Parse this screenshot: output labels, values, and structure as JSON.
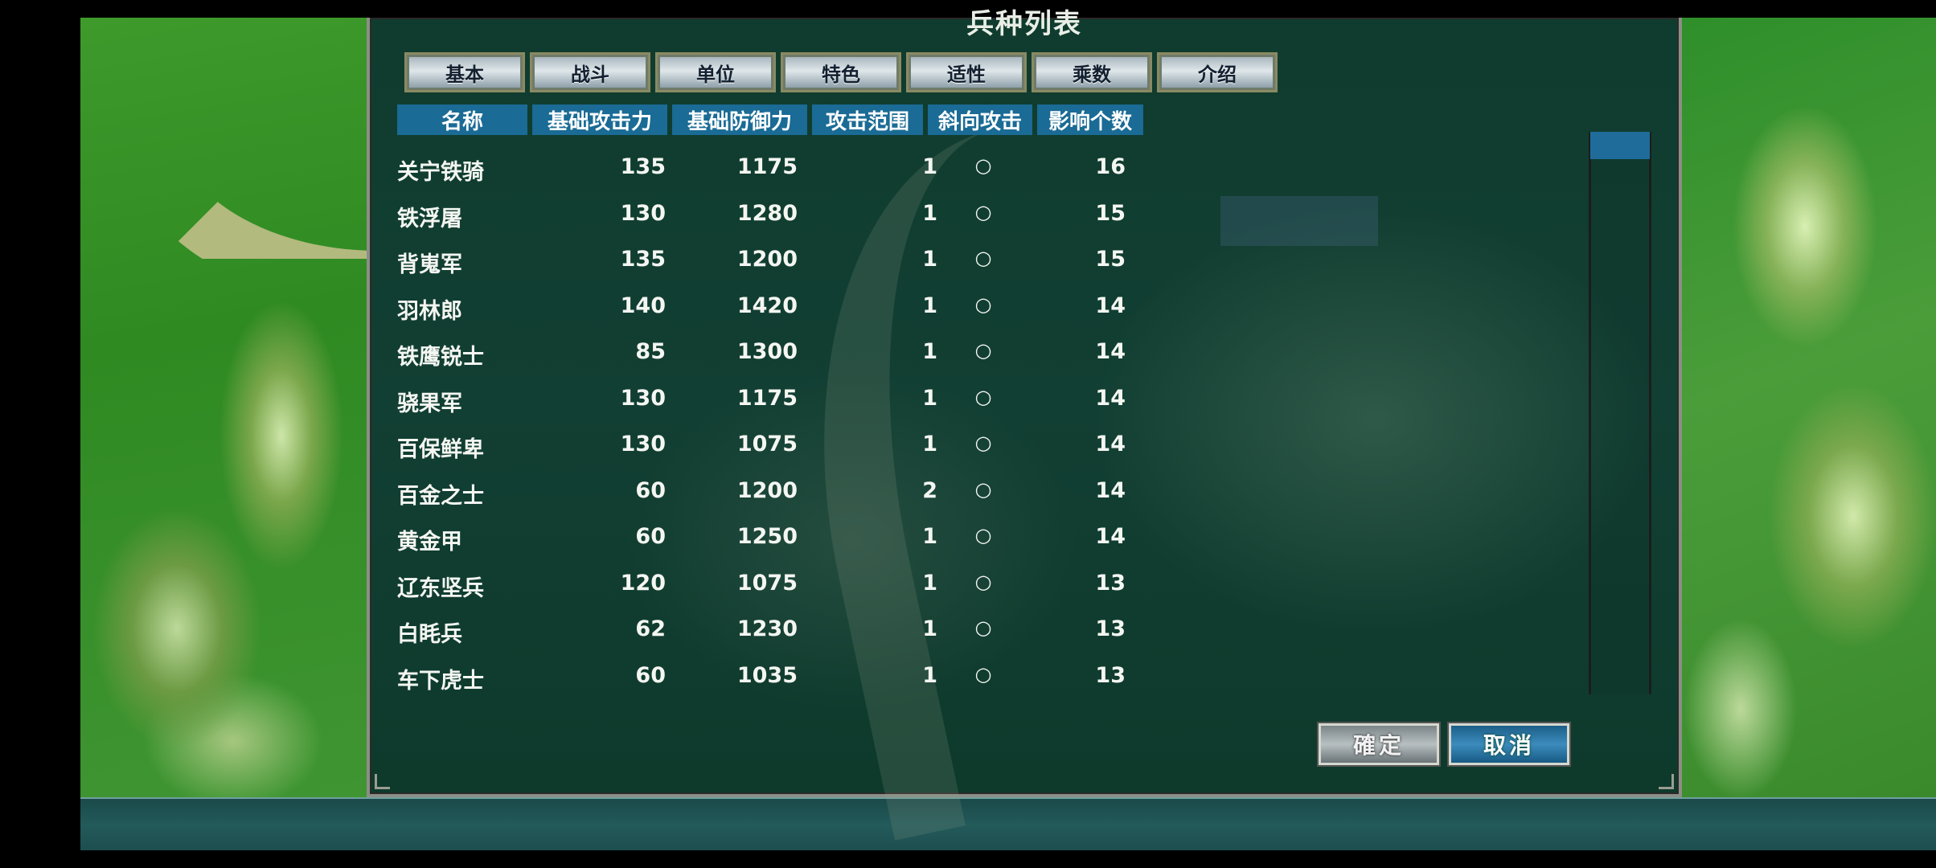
{
  "dialog": {
    "title": "兵种列表"
  },
  "tabs": [
    {
      "label": "基本"
    },
    {
      "label": "战斗"
    },
    {
      "label": "单位"
    },
    {
      "label": "特色"
    },
    {
      "label": "适性"
    },
    {
      "label": "乘数"
    },
    {
      "label": "介绍"
    }
  ],
  "table": {
    "headers": [
      "名称",
      "基础攻击力",
      "基础防御力",
      "攻击范围",
      "斜向攻击",
      "影响个数"
    ],
    "rows": [
      {
        "name": "关宁铁骑",
        "atk": "135",
        "def": "1175",
        "range": "1",
        "diag": "○",
        "count": "16"
      },
      {
        "name": "铁浮屠",
        "atk": "130",
        "def": "1280",
        "range": "1",
        "diag": "○",
        "count": "15"
      },
      {
        "name": "背嵬军",
        "atk": "135",
        "def": "1200",
        "range": "1",
        "diag": "○",
        "count": "15"
      },
      {
        "name": "羽林郎",
        "atk": "140",
        "def": "1420",
        "range": "1",
        "diag": "○",
        "count": "14"
      },
      {
        "name": "铁鹰锐士",
        "atk": "85",
        "def": "1300",
        "range": "1",
        "diag": "○",
        "count": "14"
      },
      {
        "name": "骁果军",
        "atk": "130",
        "def": "1175",
        "range": "1",
        "diag": "○",
        "count": "14"
      },
      {
        "name": "百保鲜卑",
        "atk": "130",
        "def": "1075",
        "range": "1",
        "diag": "○",
        "count": "14"
      },
      {
        "name": "百金之士",
        "atk": "60",
        "def": "1200",
        "range": "2",
        "diag": "○",
        "count": "14"
      },
      {
        "name": "黄金甲",
        "atk": "60",
        "def": "1250",
        "range": "1",
        "diag": "○",
        "count": "14"
      },
      {
        "name": "辽东坚兵",
        "atk": "120",
        "def": "1075",
        "range": "1",
        "diag": "○",
        "count": "13"
      },
      {
        "name": "白眊兵",
        "atk": "62",
        "def": "1230",
        "range": "1",
        "diag": "○",
        "count": "13"
      },
      {
        "name": "车下虎士",
        "atk": "60",
        "def": "1035",
        "range": "1",
        "diag": "○",
        "count": "13"
      }
    ]
  },
  "buttons": {
    "ok": "確定",
    "cancel": "取消"
  },
  "colors": {
    "header_bg": "#1a6b95",
    "dialog_bg": "#0f3c2e",
    "cancel_bg": "#1c5f88"
  }
}
